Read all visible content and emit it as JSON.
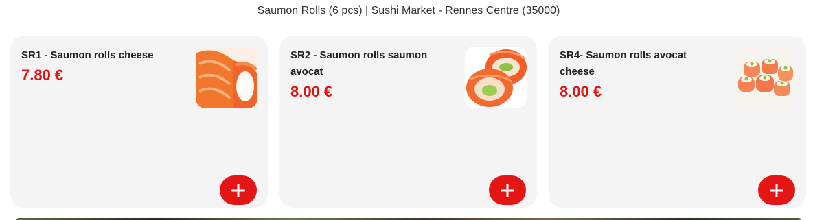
{
  "page": {
    "title": "Saumon Rolls (6 pcs) | Sushi Market - Rennes Centre (35000)"
  },
  "products": [
    {
      "name": "SR1 - Saumon rolls cheese",
      "price": "7.80 €",
      "image_icon": "salmon-roll-cheese-image"
    },
    {
      "name": "SR2 - Saumon rolls saumon avocat",
      "price": "8.00 €",
      "image_icon": "salmon-roll-avocado-image"
    },
    {
      "name": "SR4- Saumon rolls avocat cheese",
      "price": "8.00 €",
      "image_icon": "salmon-roll-avocado-cheese-image"
    }
  ],
  "colors": {
    "price": "#e31212",
    "add_button": "#e51515",
    "card_background": "#f4f4f4"
  },
  "icons": {
    "add": "plus-icon"
  }
}
